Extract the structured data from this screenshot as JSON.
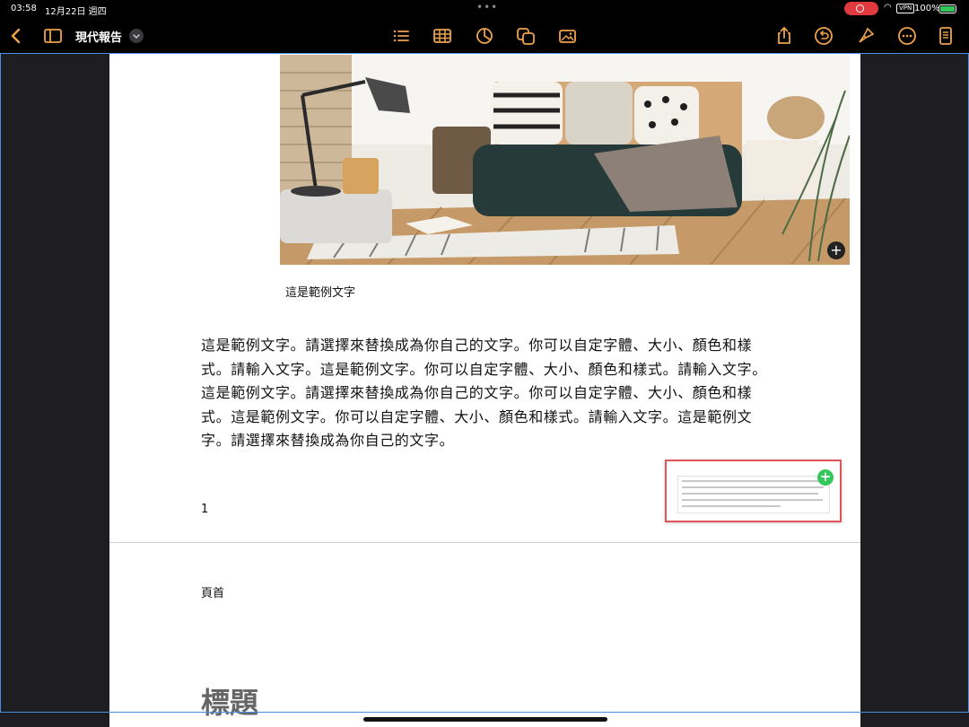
{
  "status_bar": {
    "time": "03:58",
    "date": "12月22日 週四",
    "battery": "100%",
    "vpn": "VPN"
  },
  "toolbar": {
    "document_title": "現代報告",
    "icons": [
      "back-icon",
      "sidebar-icon",
      "chevron-down-icon",
      "list-icon",
      "table-icon",
      "chart-icon",
      "shape-icon",
      "media-icon",
      "share-icon",
      "undo-icon",
      "format-brush-icon",
      "more-icon",
      "document-settings-icon"
    ],
    "accent_color": "#f0a34a"
  },
  "document": {
    "image_caption": "這是範例文字",
    "body_text": "這是範例文字。請選擇來替換成為你自己的文字。你可以自定字體、大小、顏色和樣式。請輸入文字。這是範例文字。你可以自定字體、大小、顏色和樣式。請輸入文字。這是範例文字。請選擇來替換成為你自己的文字。你可以自定字體、大小、顏色和樣式。這是範例文字。你可以自定字體、大小、顏色和樣式。請輸入文字。這是範例文字。請選擇來替換成為你自己的文字。",
    "page_number": "1",
    "next_page_header": "頁首",
    "next_page_heading": "標題"
  },
  "colors": {
    "canvas": "#1e1e22",
    "page": "#ffffff",
    "selection": "#4a90e2",
    "comment_border": "#e0555a",
    "add_green": "#34c759"
  }
}
